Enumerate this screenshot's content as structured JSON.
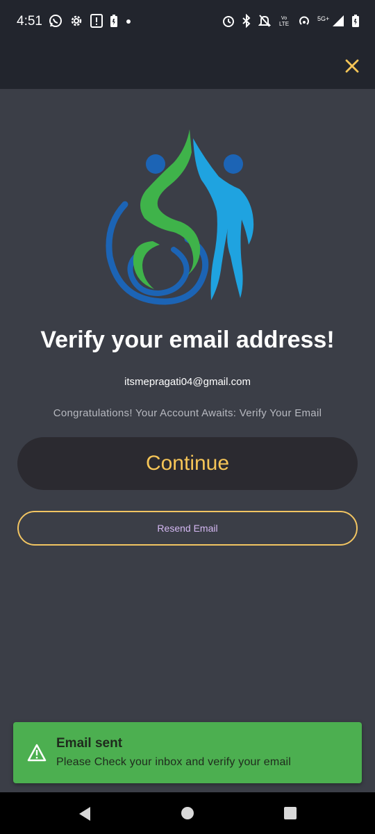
{
  "status_bar": {
    "time": "4:51",
    "left_icons": [
      "whatsapp-icon",
      "settings-gear-icon",
      "notification-card-icon",
      "battery-saver-icon",
      "dot-icon"
    ],
    "right_icons": [
      "alarm-icon",
      "bluetooth-icon",
      "mute-icon",
      "volte-icon",
      "hotspot-icon",
      "5g-signal-icon",
      "battery-icon"
    ],
    "volte_label": "Vo LTE",
    "network_label": "5G+"
  },
  "app_bar": {
    "close_icon": "close-icon",
    "accent_color": "#f6c557"
  },
  "logo": {
    "icon": "accessibility-high-five-logo",
    "colors": {
      "blue_dark": "#1c64b5",
      "green": "#3fb34a",
      "blue_light": "#1fa3e0"
    }
  },
  "content": {
    "title": "Verify your email address!",
    "email": "itsmepragati04@gmail.com",
    "subtitle": "Congratulations! Your Account Awaits: Verify Your Email"
  },
  "buttons": {
    "continue_label": "Continue",
    "resend_label": "Resend Email"
  },
  "snackbar": {
    "icon": "warning-icon",
    "title": "Email sent",
    "message": "Please Check your inbox and verify your email",
    "background": "#4caf50"
  },
  "nav_bar": {
    "icons": [
      "back-icon",
      "home-icon",
      "recents-icon"
    ]
  }
}
